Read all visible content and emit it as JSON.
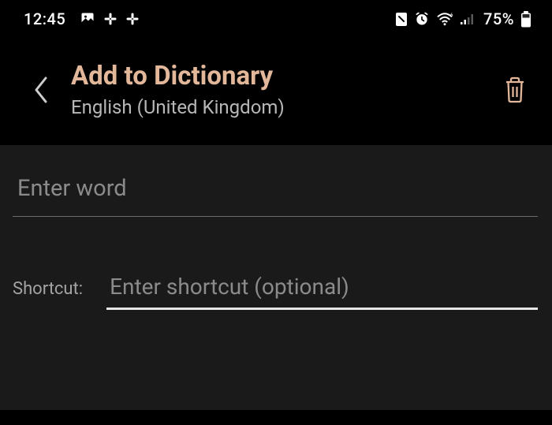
{
  "status": {
    "time": "12:45",
    "battery_pct": "75%"
  },
  "header": {
    "title": "Add to Dictionary",
    "subtitle": "English (United Kingdom)"
  },
  "form": {
    "word_placeholder": "Enter word",
    "word_value": "",
    "shortcut_label": "Shortcut:",
    "shortcut_placeholder": "Enter shortcut (optional)",
    "shortcut_value": ""
  },
  "colors": {
    "accent": "#e2b79a",
    "bg_body": "#000000",
    "bg_content": "#1a1a1a"
  }
}
